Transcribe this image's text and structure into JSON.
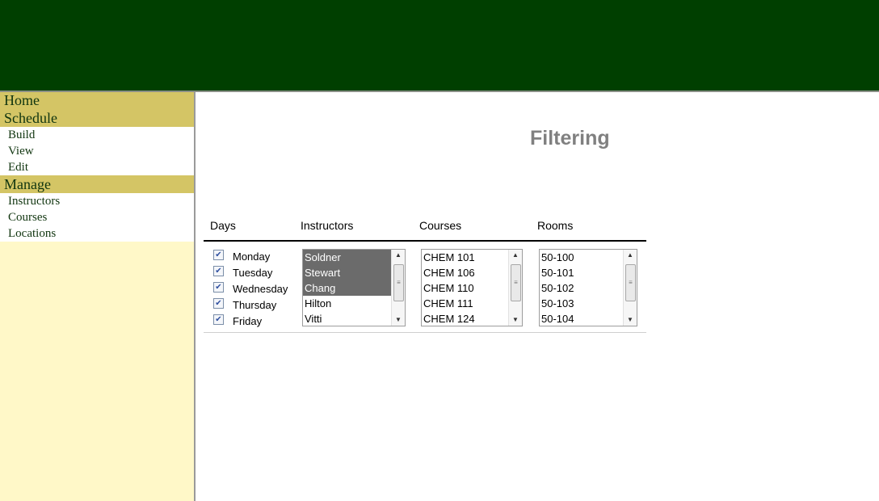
{
  "sidebar": {
    "home": "Home",
    "schedule": "Schedule",
    "schedule_items": [
      "Build",
      "View",
      "Edit"
    ],
    "manage": "Manage",
    "manage_items": [
      "Instructors",
      "Courses",
      "Locations"
    ]
  },
  "page": {
    "title": "Filtering"
  },
  "columns": {
    "days": "Days",
    "instructors": "Instructors",
    "courses": "Courses",
    "rooms": "Rooms"
  },
  "days": [
    {
      "label": "Monday",
      "checked": true
    },
    {
      "label": "Tuesday",
      "checked": true
    },
    {
      "label": "Wednesday",
      "checked": true
    },
    {
      "label": "Thursday",
      "checked": true
    },
    {
      "label": "Friday",
      "checked": true
    }
  ],
  "instructors": {
    "options": [
      "Soldner",
      "Stewart",
      "Chang",
      "Hilton",
      "Vitti"
    ],
    "selected": [
      "Soldner",
      "Stewart",
      "Chang"
    ]
  },
  "courses": {
    "options": [
      "CHEM 101",
      "CHEM 106",
      "CHEM 110",
      "CHEM 111",
      "CHEM 124"
    ]
  },
  "rooms": {
    "options": [
      "50-100",
      "50-101",
      "50-102",
      "50-103",
      "50-104"
    ]
  },
  "colors": {
    "header": "#003f00",
    "section": "#d4c565",
    "sidebar_bg": "#fff8c8",
    "selected": "#6b6b6b"
  },
  "icons": {
    "checkbox": "checkmark-icon",
    "scroll_up": "scroll-up-arrow-icon",
    "scroll_down": "scroll-down-arrow-icon"
  }
}
